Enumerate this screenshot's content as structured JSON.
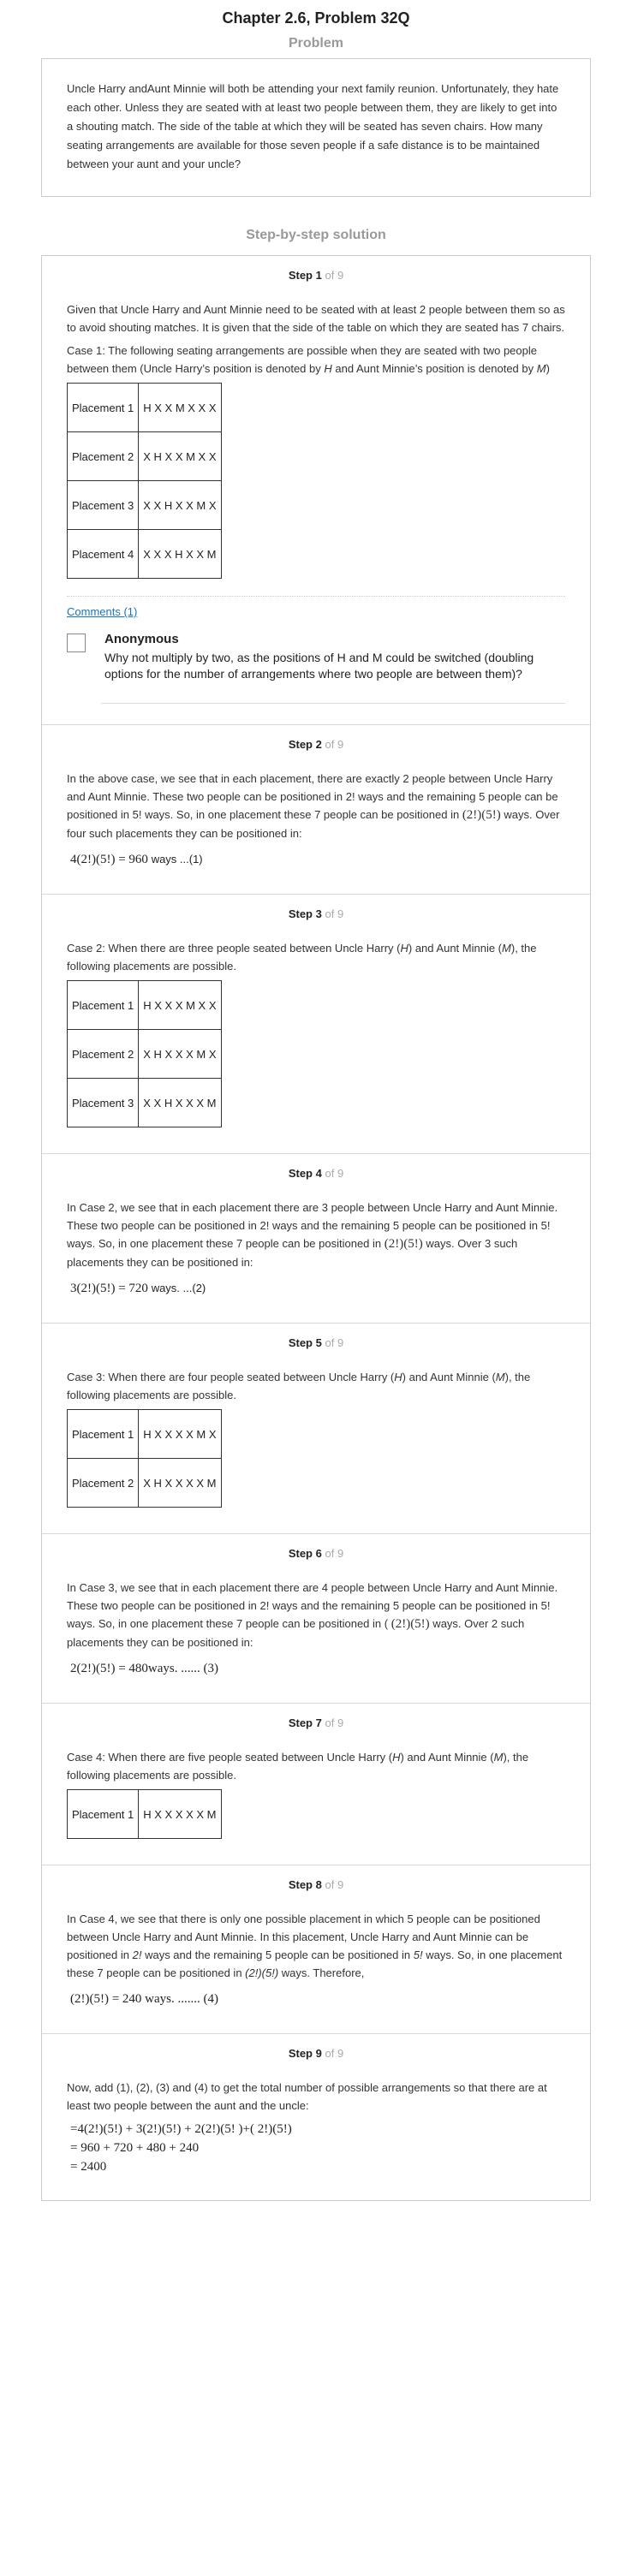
{
  "page": {
    "title": "Chapter 2.6, Problem 32Q",
    "problem_heading": "Problem",
    "solution_heading": "Step-by-step solution"
  },
  "problem": {
    "text": "Uncle Harry andAunt Minnie will both be attending your next family reunion. Unfortunately, they hate each other. Unless they are seated with at least two people between them, they are likely to get into a shouting match. The side of the table at which they will be seated has seven chairs. How many seating arrangements are available for those seven people if a safe distance is to be maintained between your aunt and your uncle?"
  },
  "steps": {
    "total": "9",
    "of_word": "of",
    "step_word": "Step",
    "s1": {
      "num": "1",
      "p1": "Given that Uncle Harry and Aunt Minnie need to be seated with at least 2 people between them so as to avoid shouting matches. It is given that the side of the table on which they are seated has 7 chairs.",
      "p2_a": "Case 1: The following seating arrangements are possible when they are seated with two people between them (Uncle Harry’s position is denoted by ",
      "p2_h": "H",
      "p2_b": " and Aunt Minnie’s position is denoted by ",
      "p2_m": "M",
      "p2_c": ")",
      "table": [
        [
          "Placement 1",
          "H X X M X X X"
        ],
        [
          "Placement 2",
          "X H X X M X X"
        ],
        [
          "Placement 3",
          "X X H X X M X"
        ],
        [
          "Placement 4",
          "X X X H X X M"
        ]
      ],
      "comments_link": "Comments (1)",
      "comment_author": "Anonymous",
      "comment_text": "Why not multiply by two, as the positions of H and M could be switched (doubling options for the number of arrangements where two people are between them)?"
    },
    "s2": {
      "num": "2",
      "p1_a": "In the above case, we see that in each placement, there are exactly 2 people between Uncle Harry and Aunt Minnie. These two people can be positioned in 2! ways and the remaining 5 people can be positioned in 5! ways. So, in one placement these 7 people can be positioned in ",
      "p1_math": "(2!)(5!)",
      "p1_b": " ways. Over four such placements they can be positioned in:",
      "formula": "4(2!)(5!) = 960",
      "formula_tag": "ways ...(1)"
    },
    "s3": {
      "num": "3",
      "p1_a": "Case 2: When there are three people seated between Uncle Harry (",
      "p1_h": "H",
      "p1_b": ") and Aunt Minnie (",
      "p1_m": "M",
      "p1_c": "), the following placements are possible.",
      "table": [
        [
          "Placement 1",
          "H X X X M X X"
        ],
        [
          "Placement 2",
          "X H X X X M X"
        ],
        [
          "Placement 3",
          "X X H X X X M"
        ]
      ]
    },
    "s4": {
      "num": "4",
      "p1_a": "In Case 2, we see that in each placement there are 3 people between Uncle Harry and Aunt Minnie. These two people can be positioned in 2! ways and the remaining 5 people can be positioned in 5! ways. So, in one placement these 7 people can be positioned in ",
      "p1_math": "(2!)(5!)",
      "p1_b": " ways. Over 3 such placements they can be positioned in:",
      "formula": "3(2!)(5!) = 720",
      "formula_tag": "ways. ...(2)"
    },
    "s5": {
      "num": "5",
      "p1_a": "Case 3: When there are four people seated between Uncle Harry (",
      "p1_h": "H",
      "p1_b": ") and Aunt Minnie (",
      "p1_m": "M",
      "p1_c": "), the following placements are possible.",
      "table": [
        [
          "Placement 1",
          "H X X X X M X"
        ],
        [
          "Placement 2",
          "X H X X X X M"
        ]
      ]
    },
    "s6": {
      "num": "6",
      "p1_a": "In Case 3, we see that in each placement there are 4 people between Uncle Harry and Aunt Minnie. These two people can be positioned in 2! ways and the remaining 5 people can be positioned in 5! ways. So, in one placement these 7 people can be positioned in ( ",
      "p1_math": "(2!)(5!)",
      "p1_b": " ways. Over 2 such placements they can be positioned in:",
      "formula": "2(2!)(5!) = 480ways. ...... (3)"
    },
    "s7": {
      "num": "7",
      "p1_a": "Case 4: When there are five people seated between Uncle Harry (",
      "p1_h": "H",
      "p1_b": ") and Aunt Minnie (",
      "p1_m": "M",
      "p1_c": "), the following placements are possible.",
      "table": [
        [
          "Placement 1",
          "H X X X X X M"
        ]
      ]
    },
    "s8": {
      "num": "8",
      "p1_a": "In Case 4, we see that there is only one possible placement in which 5 people can be positioned between Uncle Harry and Aunt Minnie. In this placement, Uncle Harry and Aunt Minnie can be positioned in ",
      "p1_2": "2!",
      "p1_b": " ways and the remaining 5 people can be positioned in ",
      "p1_5": "5!",
      "p1_c": " ways. So, in one placement these 7 people can be positioned in ",
      "p1_math": "(2!)(5!)",
      "p1_d": " ways. Therefore,",
      "formula": "(2!)(5!) = 240 ways. ....... (4)"
    },
    "s9": {
      "num": "9",
      "p1": "Now, add (1), (2), (3) and (4) to get the total number of possible arrangements so that there are at least two people between the aunt and the uncle:",
      "line1": "=4(2!)(5!) + 3(2!)(5!) + 2(2!)(5! )+( 2!)(5!)",
      "line2": "= 960 + 720 + 480 + 240",
      "line3": "= 2400"
    }
  }
}
